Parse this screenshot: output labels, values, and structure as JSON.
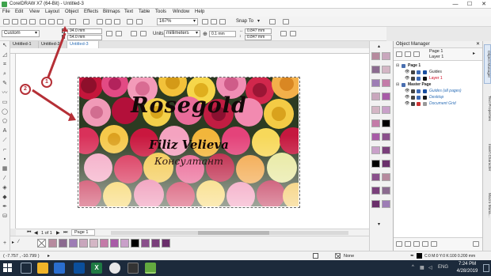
{
  "window": {
    "title": "CorelDRAW X7 (64-Bit) - Untitled-3",
    "minimize": "—",
    "maximize": "☐",
    "close": "✕"
  },
  "menu": [
    "File",
    "Edit",
    "View",
    "Layout",
    "Object",
    "Effects",
    "Bitmaps",
    "Text",
    "Table",
    "Tools",
    "Window",
    "Help"
  ],
  "toolbar": {
    "zoom": "167%",
    "snap_to": "Snap To"
  },
  "propertybar": {
    "preset": "Custom",
    "width": "94.0 mm",
    "height": "54.0 mm",
    "units_label": "Units:",
    "units_value": "millimeters",
    "nudge": "0.1 mm",
    "dup_x": "0.847 mm",
    "dup_y": "0.847 mm"
  },
  "tabs": [
    {
      "label": "Untitled-1"
    },
    {
      "label": "Untitled-2"
    },
    {
      "label": "Untitled-3"
    }
  ],
  "design": {
    "title": "Rosegold",
    "name": "Filiz Velieva",
    "subtitle": "Консултант"
  },
  "callouts": [
    "1",
    "2"
  ],
  "page_nav": {
    "counter": "1 of 1",
    "page_tab": "Page 1"
  },
  "object_manager": {
    "header": "Object Manager",
    "page_label": "Page 1",
    "layer_label": "Layer 1",
    "rows": [
      {
        "label": "Page 1",
        "bold": true
      },
      {
        "label": "Guides",
        "bold": false
      },
      {
        "label": "Layer 1",
        "bold": false,
        "color": "#d0021b"
      },
      {
        "label": "Master Page",
        "bold": true
      },
      {
        "label": "Guides (all pages)",
        "bold": false
      },
      {
        "label": "Desktop",
        "bold": false
      },
      {
        "label": "Document Grid",
        "bold": false
      }
    ]
  },
  "side_tabs": [
    "Object Manager",
    "Text Properties",
    "Insert Character",
    "Macro Mana..."
  ],
  "status": {
    "coords": "( -7.757 , -10.799 )",
    "fill_label": "None",
    "outline_label": "C:0 M:0 Y:0 K:100  0.200 mm"
  },
  "taskbar": {
    "lang": "ENG",
    "time": "7:24 PM",
    "date": "4/28/2019"
  },
  "colors": {
    "accent": "#2d6fb7",
    "callout_red": "#b52f36",
    "palette": [
      "#b68a9e",
      "#8b6a8f",
      "#9d7db5",
      "#c9a7bd",
      "#d4b6c5",
      "#c47ba8",
      "#a85ba7",
      "#c9a0c9",
      "#000000",
      "#8a4f8b",
      "#7a3f7b",
      "#6a2f6b"
    ]
  }
}
